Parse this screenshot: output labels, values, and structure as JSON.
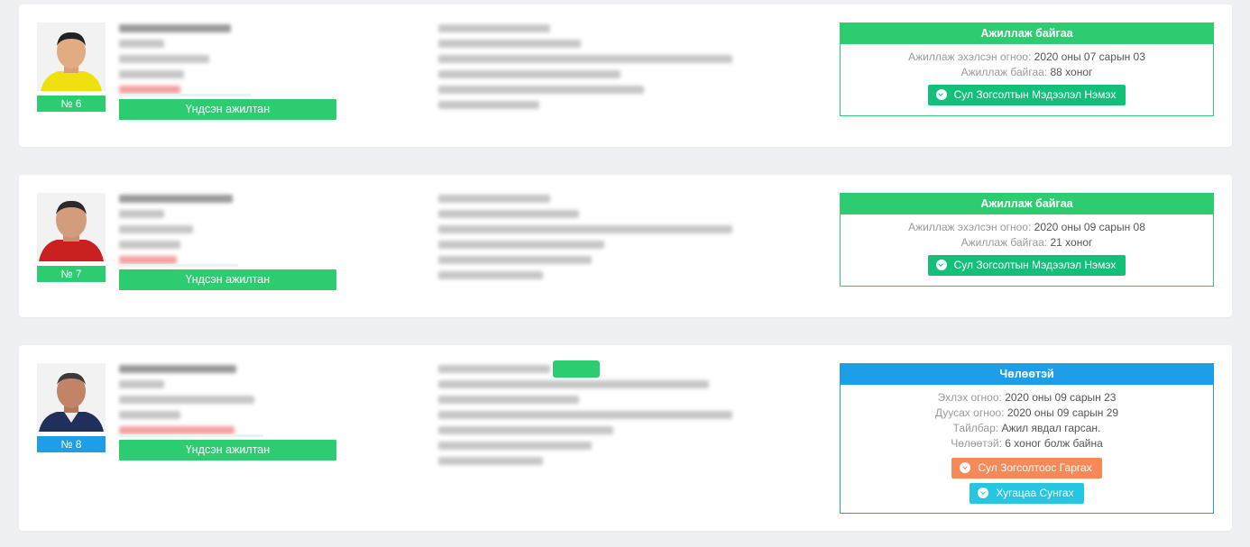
{
  "employees": [
    {
      "number": "№ 6",
      "role_button": "Үндсэн ажилтан",
      "status": {
        "header": "Ажиллаж байгаа",
        "rows": [
          {
            "label": "Ажиллаж эхэлсэн огноо: ",
            "value": "2020 оны 07 сарын 03"
          },
          {
            "label": "Ажиллаж байгаа: ",
            "value": "88 хоног"
          }
        ],
        "button": "Сул Зогсолтын Мэдээлэл Нэмэх"
      }
    },
    {
      "number": "№ 7",
      "role_button": "Үндсэн ажилтан",
      "status": {
        "header": "Ажиллаж байгаа",
        "rows": [
          {
            "label": "Ажиллаж эхэлсэн огноо: ",
            "value": "2020 оны 09 сарын 08"
          },
          {
            "label": "Ажиллаж байгаа: ",
            "value": "21 хоног"
          }
        ],
        "button": "Сул Зогсолтын Мэдээлэл Нэмэх"
      }
    },
    {
      "number": "№ 8",
      "role_button": "Үндсэн ажилтан",
      "status": {
        "header": "Чөлөөтэй",
        "rows": [
          {
            "label": "Эхлэх огноо: ",
            "value": "2020 оны 09 сарын 23"
          },
          {
            "label": "Дуусах огноо: ",
            "value": "2020 оны 09 сарын 29"
          },
          {
            "label": "Тайлбар: ",
            "value": "Ажил явдал гарсан."
          },
          {
            "label": "Чөлөөтэй: ",
            "value": "6 хоног болж байна"
          }
        ],
        "button_primary": "Сул Зогсолтоос Гаргах",
        "button_secondary": "Хугацаа Сунгах"
      }
    }
  ],
  "colors": {
    "working": "#2ecc71",
    "leave": "#1e9ee6",
    "add_button": "#14bf7a",
    "remove_button": "#f58a58",
    "extend_button": "#24c6e2"
  },
  "icons": [
    "chevron-down-circle-icon"
  ]
}
